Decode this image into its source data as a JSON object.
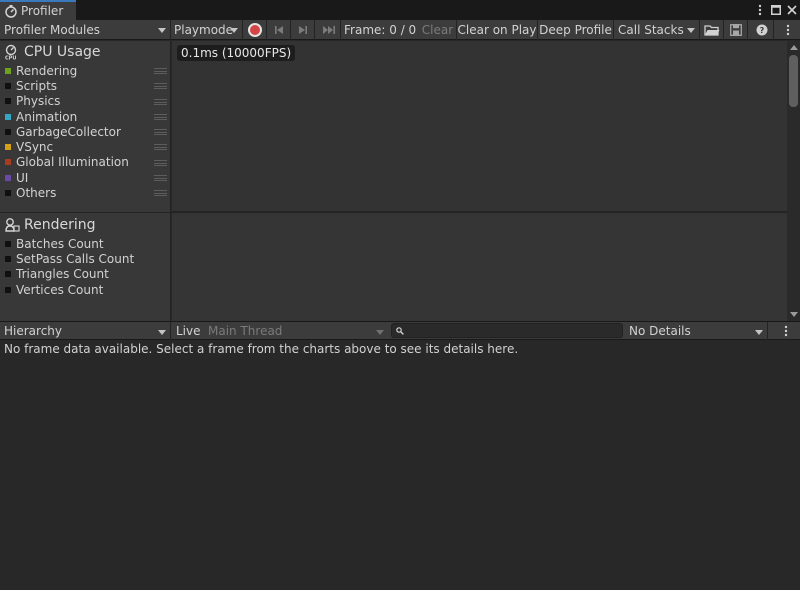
{
  "window": {
    "tab_title": "Profiler"
  },
  "toolbar": {
    "modules_label": "Profiler Modules",
    "playmode_label": "Playmode",
    "frame_label": "Frame: 0 / 0",
    "clear_label": "Clear",
    "clear_on_play_label": "Clear on Play",
    "deep_profile_label": "Deep Profile",
    "call_stacks_label": "Call Stacks"
  },
  "modules": {
    "cpu": {
      "title": "CPU Usage",
      "items": [
        {
          "label": "Rendering",
          "color": "#6fa21c"
        },
        {
          "label": "Scripts",
          "color": "#101010"
        },
        {
          "label": "Physics",
          "color": "#101010"
        },
        {
          "label": "Animation",
          "color": "#34a6c4"
        },
        {
          "label": "GarbageCollector",
          "color": "#101010"
        },
        {
          "label": "VSync",
          "color": "#d4a017"
        },
        {
          "label": "Global Illumination",
          "color": "#a83c20"
        },
        {
          "label": "UI",
          "color": "#6a4aa5"
        },
        {
          "label": "Others",
          "color": "#101010"
        }
      ]
    },
    "rendering": {
      "title": "Rendering",
      "items": [
        {
          "label": "Batches Count",
          "color": "#101010"
        },
        {
          "label": "SetPass Calls Count",
          "color": "#101010"
        },
        {
          "label": "Triangles Count",
          "color": "#101010"
        },
        {
          "label": "Vertices Count",
          "color": "#101010"
        }
      ]
    }
  },
  "chart": {
    "fps_label": "0.1ms (10000FPS)"
  },
  "details": {
    "view_label": "Hierarchy",
    "live_label": "Live",
    "thread_label": "Main Thread",
    "search_value": "",
    "details_label": "No Details",
    "no_data_message": "No frame data available. Select a frame from the charts above to see its details here."
  }
}
